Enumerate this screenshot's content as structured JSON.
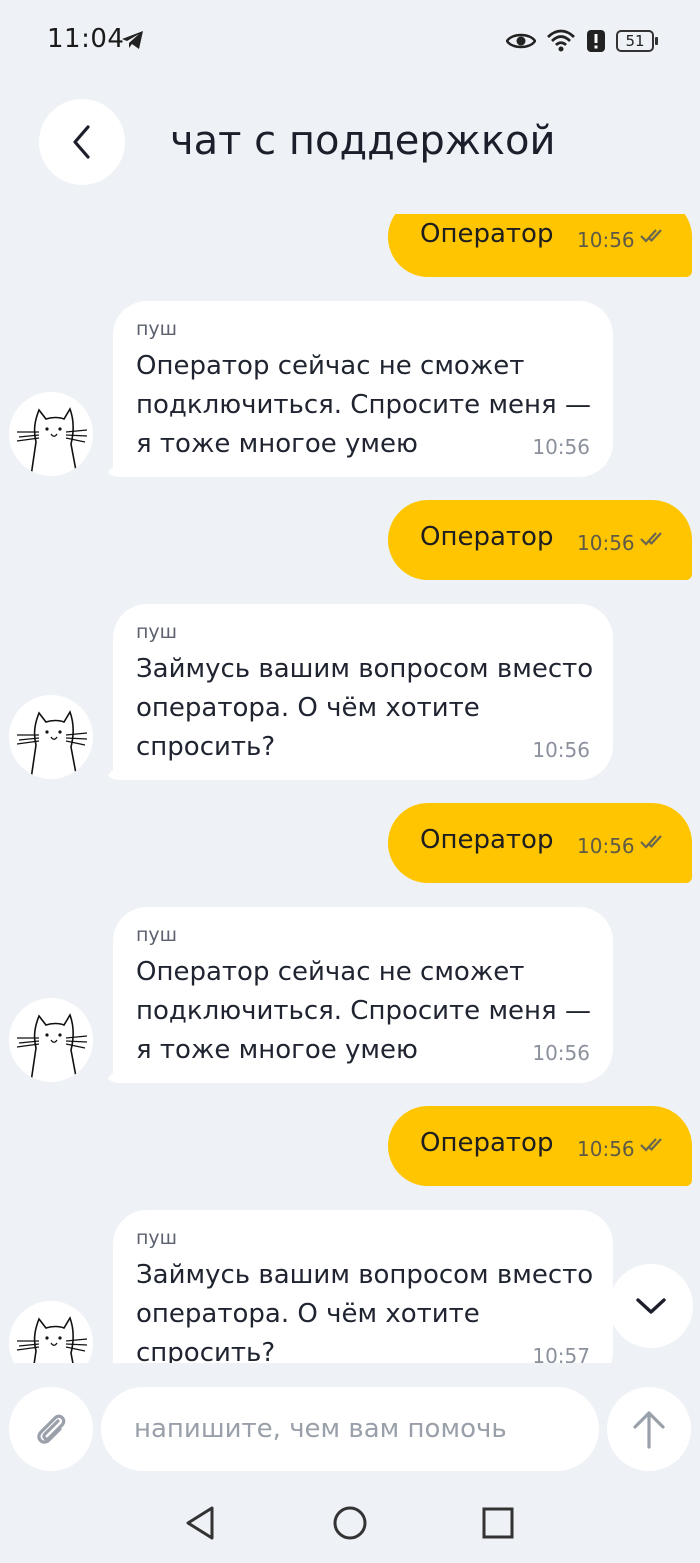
{
  "status_bar": {
    "time": "11:04",
    "battery": "51",
    "icons": [
      "telegram-icon",
      "eye-icon",
      "wifi-icon",
      "alert-icon",
      "battery-icon"
    ]
  },
  "header": {
    "title": "чат с поддержкой",
    "back_icon": "chevron-left-icon"
  },
  "messages": [
    {
      "type": "out",
      "text": "Оператор",
      "time": "10:56",
      "status": "read"
    },
    {
      "type": "in",
      "sender": "пуш",
      "lines": [
        "Оператор сейчас не сможет",
        "подключиться. Спросите меня —",
        "я тоже многое умею"
      ],
      "time": "10:56"
    },
    {
      "type": "out",
      "text": "Оператор",
      "time": "10:56",
      "status": "read"
    },
    {
      "type": "in",
      "sender": "пуш",
      "lines": [
        "Займусь вашим вопросом вместо",
        "оператора. О чём хотите",
        "спросить?"
      ],
      "time": "10:56"
    },
    {
      "type": "out",
      "text": "Оператор",
      "time": "10:56",
      "status": "read"
    },
    {
      "type": "in",
      "sender": "пуш",
      "lines": [
        "Оператор сейчас не сможет",
        "подключиться. Спросите меня —",
        "я тоже многое умею"
      ],
      "time": "10:56"
    },
    {
      "type": "out",
      "text": "Оператор",
      "time": "10:56",
      "status": "read"
    },
    {
      "type": "in",
      "sender": "пуш",
      "lines": [
        "Займусь вашим вопросом вместо",
        "оператора. О чём хотите",
        "спросить?"
      ],
      "time": "10:57"
    }
  ],
  "composer": {
    "placeholder": "напишите, чем вам помочь",
    "value": ""
  },
  "colors": {
    "background": "#eef1f5",
    "outgoing_bubble": "#ffc500",
    "incoming_bubble": "#ffffff"
  }
}
